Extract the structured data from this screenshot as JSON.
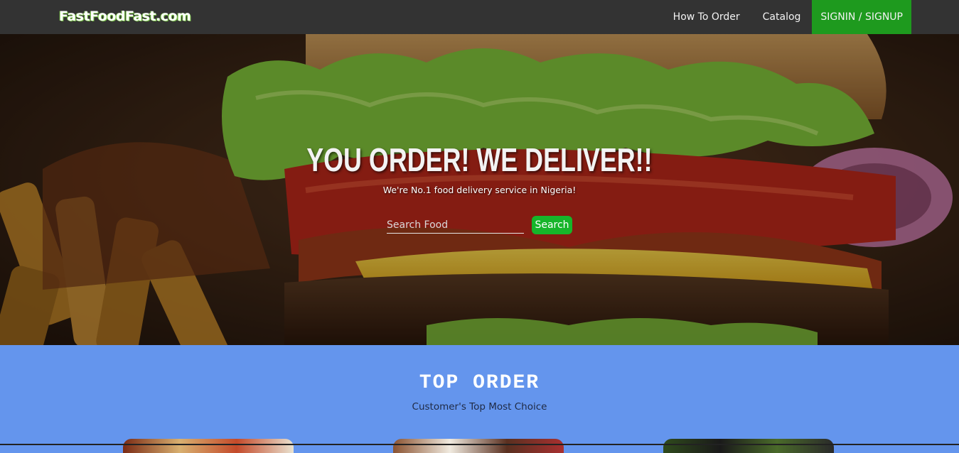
{
  "navbar": {
    "brand": "FastFoodFast.com",
    "links": [
      {
        "label": "How To Order"
      },
      {
        "label": "Catalog"
      },
      {
        "label": "SIGNIN / SIGNUP"
      }
    ]
  },
  "hero": {
    "title": "YOU ORDER! WE DELIVER!!",
    "subtitle": "We're No.1 food delivery service in Nigeria!",
    "search": {
      "placeholder": "Search Food",
      "value": "",
      "button_label": "Search"
    }
  },
  "top_order": {
    "title": "TOP ORDER",
    "subtitle": "Customer's Top Most Choice"
  },
  "colors": {
    "navbar_bg": "#333333",
    "signin_bg": "#1e9a1e",
    "search_button": "#16b52a",
    "section_bg": "#6495ed"
  }
}
